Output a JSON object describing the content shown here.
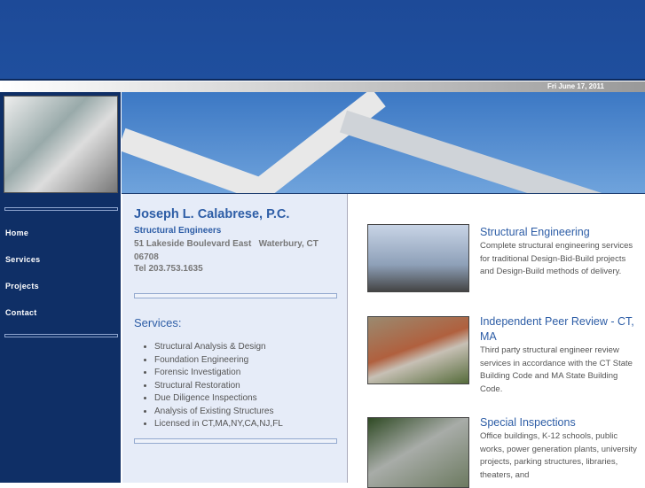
{
  "header": {
    "date": "Fri June 17, 2011"
  },
  "nav": {
    "items": [
      {
        "label": "Home"
      },
      {
        "label": "Services"
      },
      {
        "label": "Projects"
      },
      {
        "label": "Contact"
      }
    ]
  },
  "company": {
    "name": "Joseph L. Calabrese, P.C.",
    "tagline": "Structural Engineers",
    "address": "51 Lakeside Boulevard East   Waterbury, CT 06708",
    "phone": "Tel 203.753.1635"
  },
  "services": {
    "heading": "Services:",
    "items": [
      "Structural Analysis & Design",
      "Foundation Engineering",
      "Forensic Investigation",
      "Structural Restoration",
      "Due Diligence Inspections",
      "Analysis of Existing Structures",
      "Licensed in CT,MA,NY,CA,NJ,FL"
    ]
  },
  "features": [
    {
      "title": "Structural Engineering",
      "desc": "Complete structural engineering services for traditional Design-Bid-Build projects and Design-Build methods of delivery."
    },
    {
      "title": "Independent Peer Review - CT, MA",
      "desc": "Third party structural engineer review services in accordance with the CT State Building Code and MA State Building Code."
    },
    {
      "title": "Special Inspections",
      "desc": "Office buildings, K-12 schools, public works, power generation plants, university projects, parking structures, libraries, theaters, and"
    }
  ]
}
